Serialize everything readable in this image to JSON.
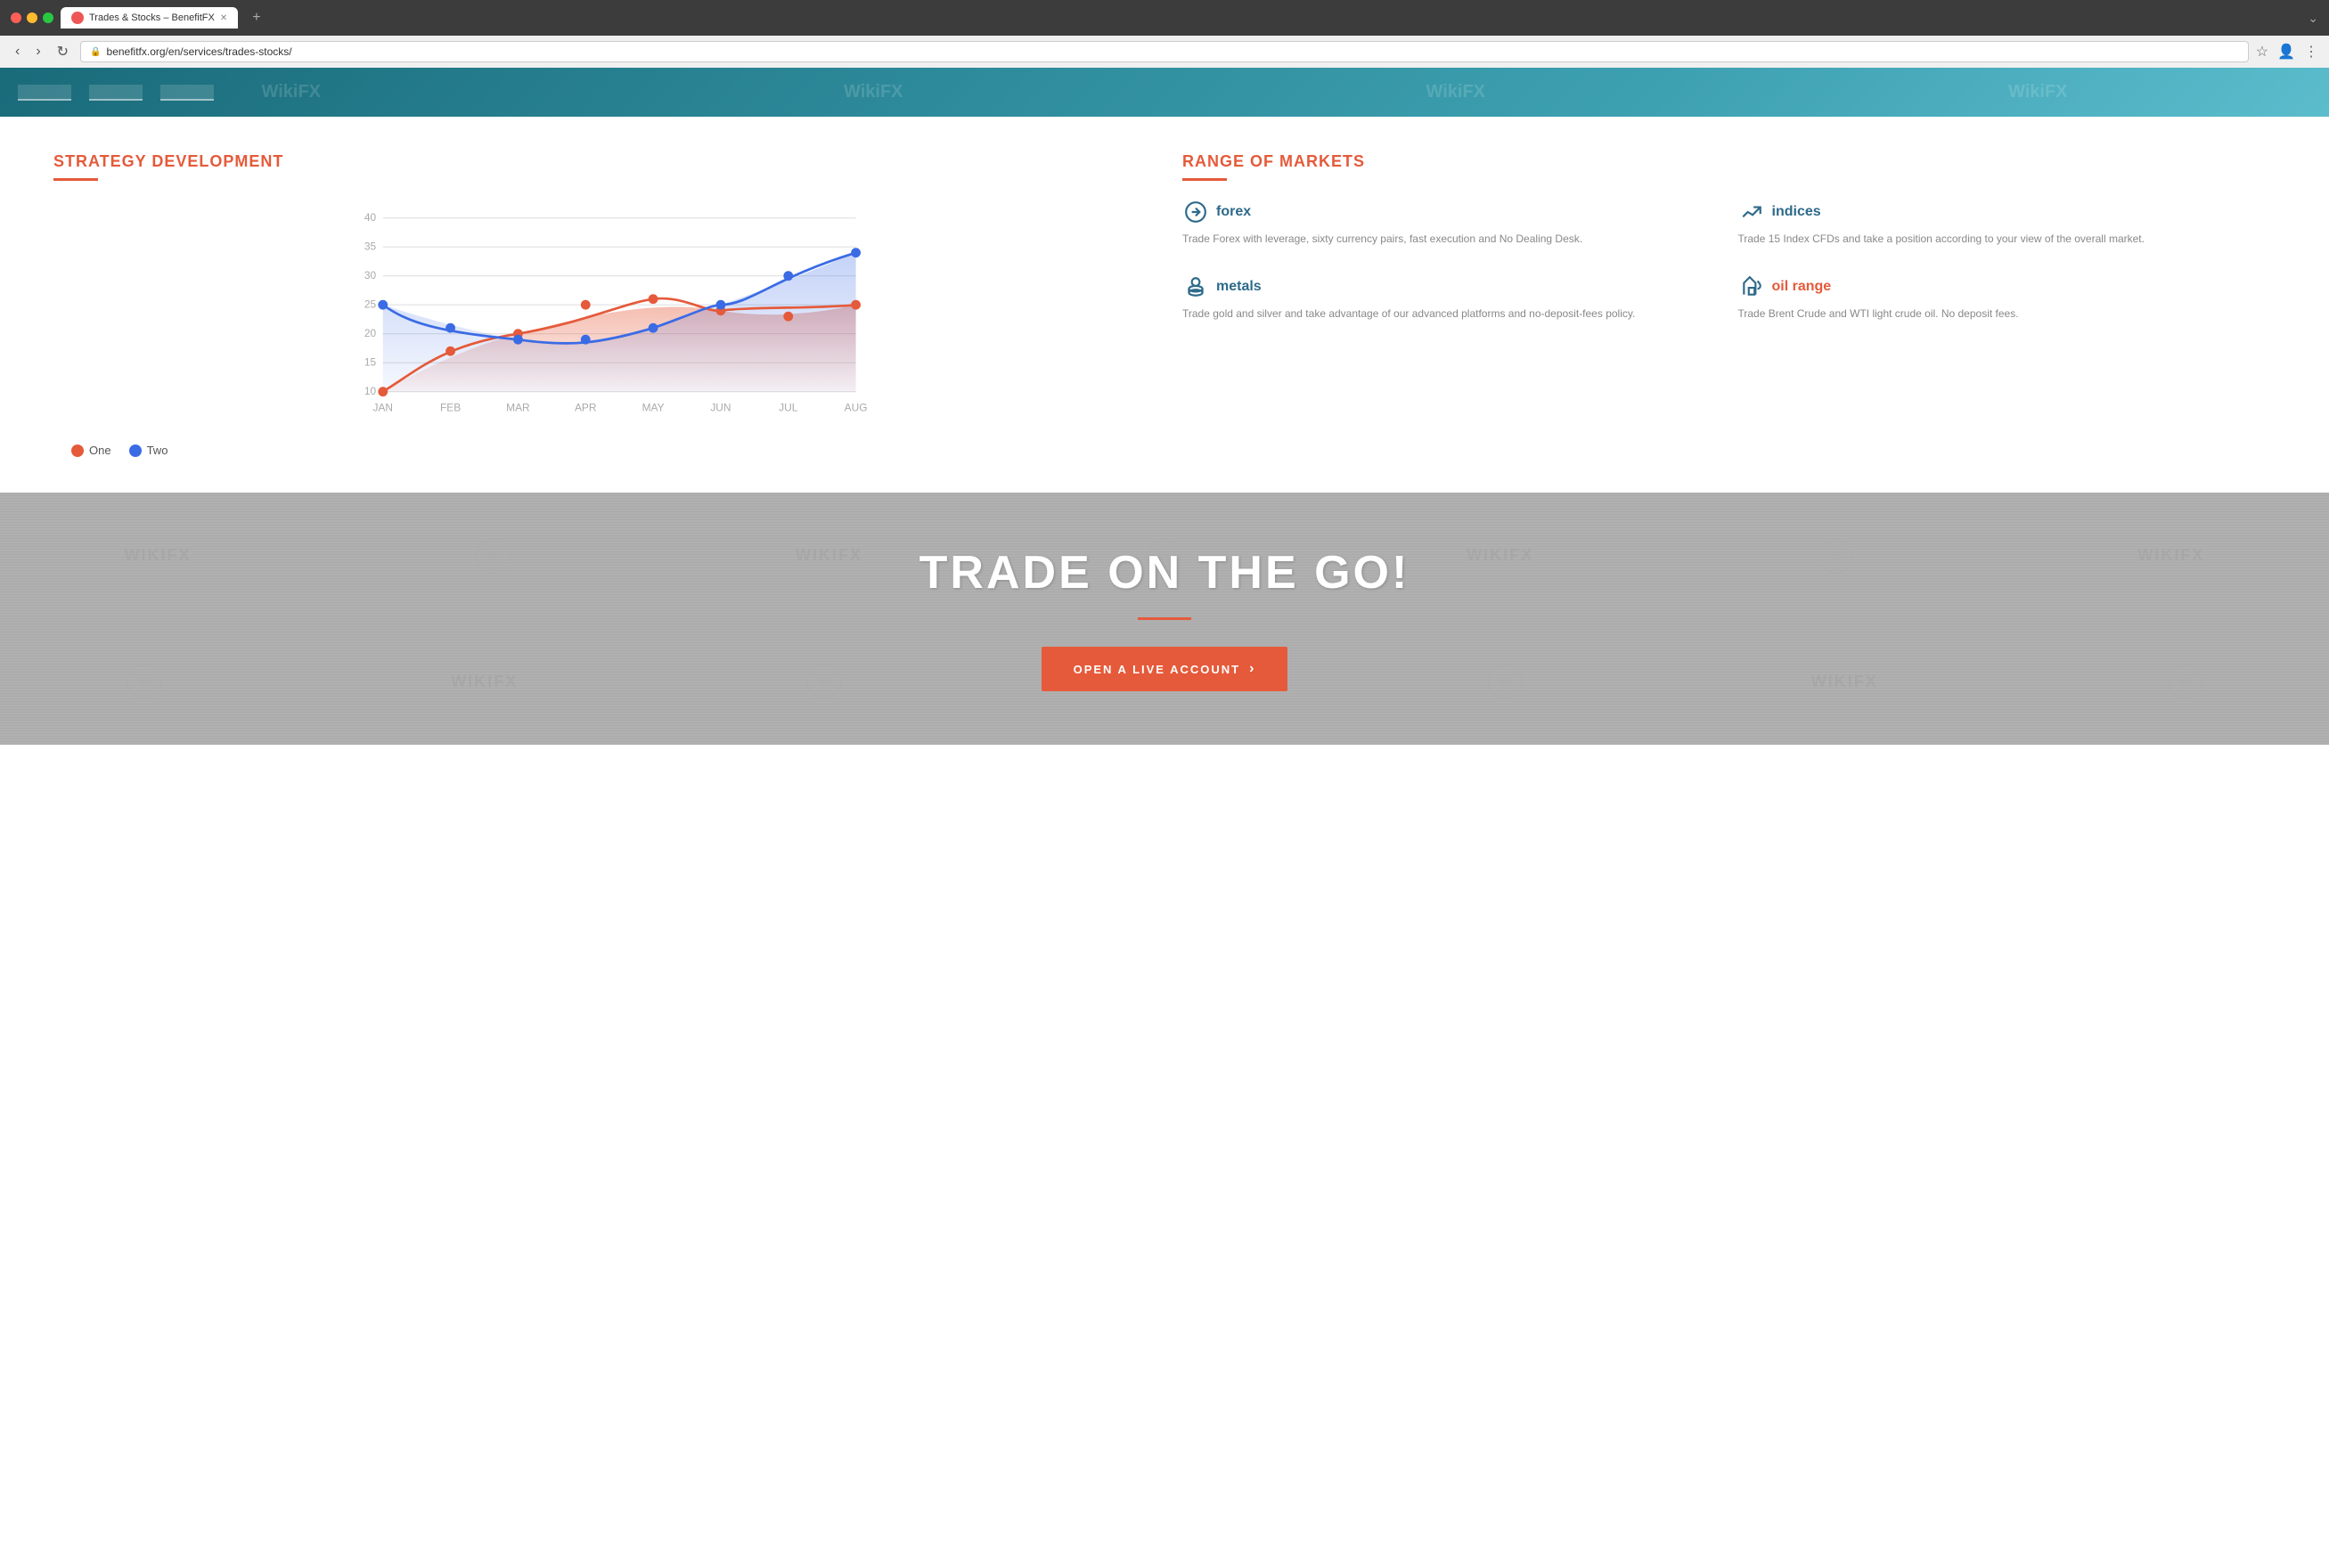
{
  "browser": {
    "tab_title": "Trades & Stocks – BenefitFX",
    "url": "benefitfx.org/en/services/trades-stocks/",
    "new_tab_label": "+"
  },
  "header_tabs": [
    {
      "label": ""
    },
    {
      "label": ""
    },
    {
      "label": ""
    }
  ],
  "strategy": {
    "section_title": "STRATEGY DEVELOPMENT",
    "chart": {
      "y_labels": [
        "40",
        "35",
        "30",
        "25",
        "20",
        "15",
        "10"
      ],
      "x_labels": [
        "JAN",
        "FEB",
        "MAR",
        "APR",
        "MAY",
        "JUN",
        "JUL",
        "AUG"
      ],
      "series_one": {
        "name": "One",
        "color": "#e55a3a",
        "points": [
          10,
          17,
          20,
          25,
          26,
          24,
          23,
          25
        ]
      },
      "series_two": {
        "name": "Two",
        "color": "#3a6be5",
        "points": [
          25,
          19,
          17,
          17,
          21,
          25,
          30,
          34
        ]
      }
    },
    "legend": [
      {
        "label": "One",
        "color": "#e55a3a"
      },
      {
        "label": "Two",
        "color": "#3a6be5"
      }
    ]
  },
  "markets": {
    "section_title": "RANGE OF MARKETS",
    "items": [
      {
        "id": "forex",
        "name": "forex",
        "name_color": "blue",
        "icon": "🎯",
        "description": "Trade Forex with leverage, sixty currency pairs, fast execution and No Dealing Desk."
      },
      {
        "id": "indices",
        "name": "indices",
        "name_color": "blue",
        "icon": "📈",
        "description": "Trade 15 Index CFDs and take a position according to your view of the overall market."
      },
      {
        "id": "metals",
        "name": "metals",
        "name_color": "blue",
        "icon": "🪙",
        "description": "Trade gold and silver and take advantage of our advanced platforms and no-deposit-fees policy."
      },
      {
        "id": "oil-range",
        "name": "oil range",
        "name_color": "orange",
        "icon": "⛽",
        "description": "Trade Brent Crude and WTI light crude oil. No deposit fees."
      }
    ]
  },
  "cta": {
    "title": "TRADE ON THE GO!",
    "button_label": "OPEN A LIVE ACCOUNT"
  },
  "wikifx": {
    "watermark_text": "WikiFX"
  }
}
